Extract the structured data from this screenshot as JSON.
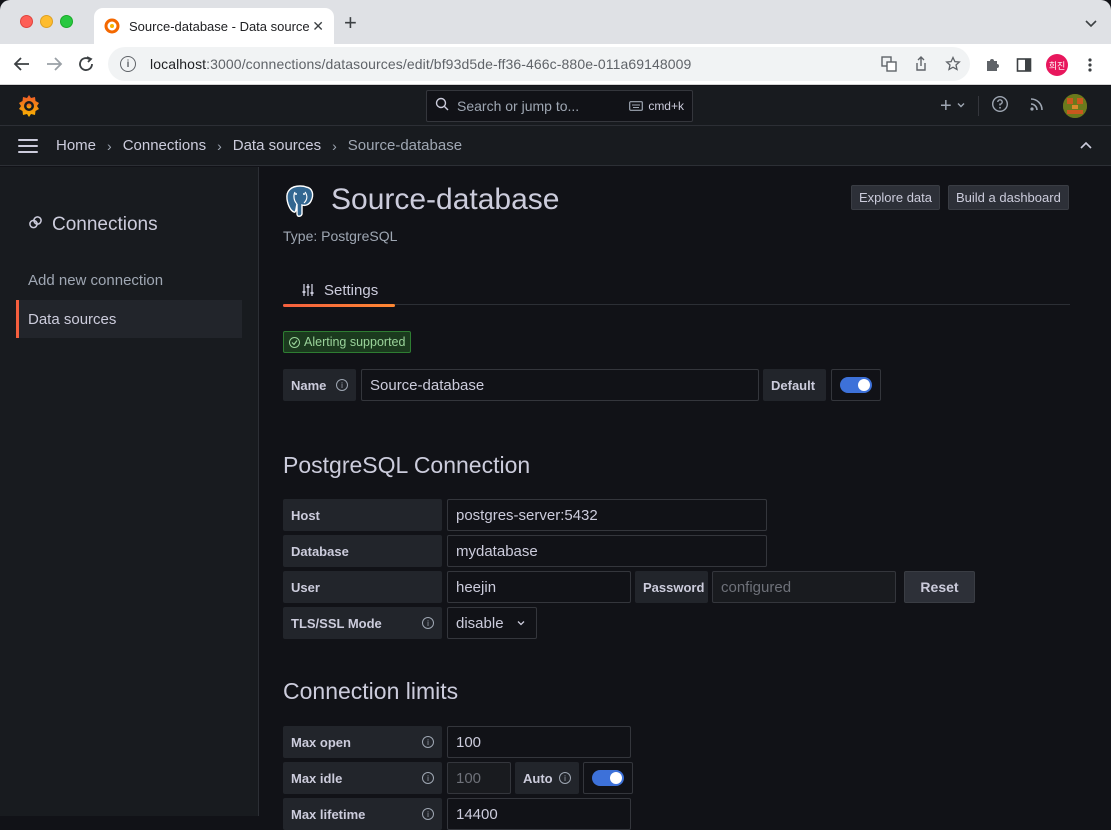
{
  "browser": {
    "tab_title": "Source-database - Data source",
    "url_host": "localhost",
    "url_rest": ":3000/connections/datasources/edit/bf93d5de-ff36-466c-880e-011a69148009",
    "profile_label": "희진"
  },
  "topbar": {
    "search_placeholder": "Search or jump to...",
    "search_shortcut": "cmd+k"
  },
  "breadcrumbs": [
    "Home",
    "Connections",
    "Data sources",
    "Source-database"
  ],
  "sidebar": {
    "title": "Connections",
    "items": [
      {
        "label": "Add new connection",
        "active": false
      },
      {
        "label": "Data sources",
        "active": true
      }
    ]
  },
  "datasource": {
    "name": "Source-database",
    "type_label": "Type: PostgreSQL",
    "explore_label": "Explore data",
    "dashboard_label": "Build a dashboard",
    "tab_settings": "Settings",
    "alerting_badge": "Alerting supported",
    "name_label": "Name",
    "name_value": "Source-database",
    "default_label": "Default",
    "default_on": true
  },
  "connection": {
    "title": "PostgreSQL Connection",
    "host_label": "Host",
    "host_value": "postgres-server:5432",
    "database_label": "Database",
    "database_value": "mydatabase",
    "user_label": "User",
    "user_value": "heejin",
    "password_label": "Password",
    "password_placeholder": "configured",
    "reset_label": "Reset",
    "tls_label": "TLS/SSL Mode",
    "tls_value": "disable"
  },
  "limits": {
    "title": "Connection limits",
    "max_open_label": "Max open",
    "max_open_value": "100",
    "max_idle_label": "Max idle",
    "max_idle_value": "100",
    "auto_label": "Auto",
    "auto_on": true,
    "max_lifetime_label": "Max lifetime",
    "max_lifetime_value": "14400"
  },
  "colors": {
    "accent": "#3d71d9",
    "brand": "#f55f3e",
    "success": "#9ad39a"
  }
}
